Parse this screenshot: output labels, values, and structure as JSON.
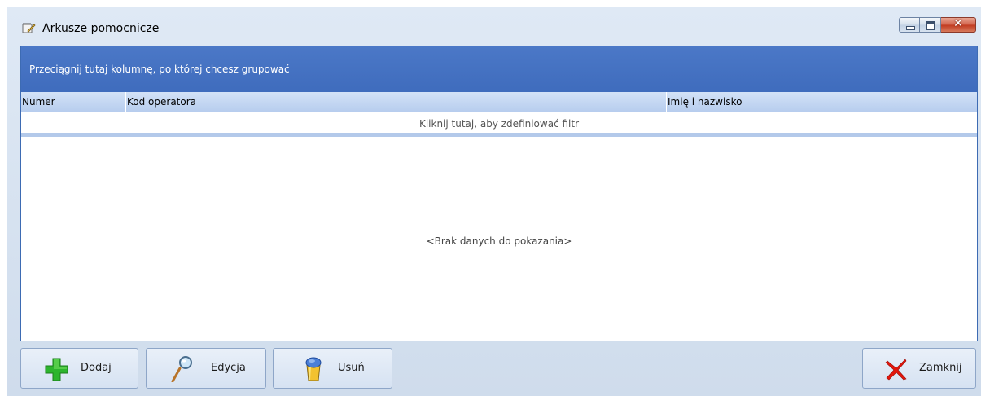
{
  "window": {
    "title": "Arkusze pomocnicze",
    "title_icon": "notebook-pencil-icon",
    "controls": {
      "minimize_icon": "minimize-icon",
      "maximize_icon": "maximize-icon",
      "close_icon": "close-icon",
      "close_glyph": "✕"
    }
  },
  "grid": {
    "group_panel_text": "Przeciągnij tutaj kolumnę, po której chcesz grupować",
    "columns": [
      "Numer",
      "Kod operatora",
      "Imię i nazwisko"
    ],
    "filter_row_text": "Kliknij tutaj, aby zdefiniować filtr",
    "empty_text": "<Brak danych do pokazania>",
    "rows": []
  },
  "toolbar": {
    "add": {
      "label": "Dodaj",
      "icon": "green-plus-icon"
    },
    "edit": {
      "label": "Edycja",
      "icon": "magnifier-icon"
    },
    "delete": {
      "label": "Usuń",
      "icon": "trash-bin-icon"
    },
    "close": {
      "label": "Zamknij",
      "icon": "red-x-icon"
    }
  },
  "colors": {
    "group_panel": "#4472c4",
    "header": "#c5d8f2",
    "window_bg": "#d6e2f0",
    "add_icon": "#2bb52b",
    "close_icon": "#e0190f"
  }
}
